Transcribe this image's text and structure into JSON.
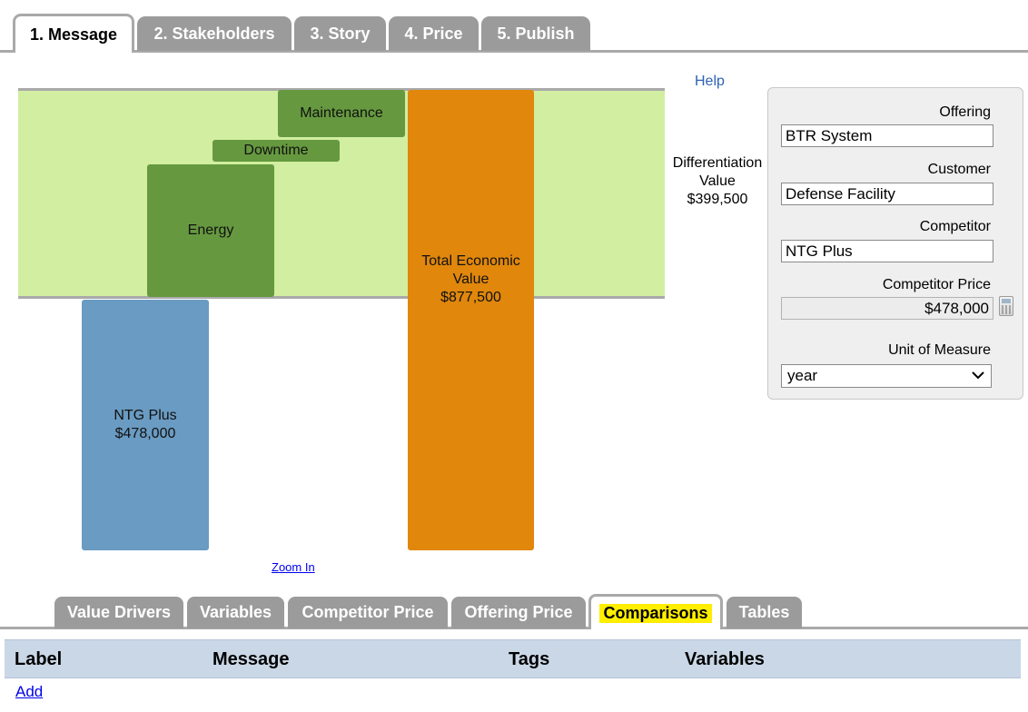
{
  "top_tabs": [
    {
      "label": "1. Message",
      "active": true
    },
    {
      "label": "2. Stakeholders",
      "active": false
    },
    {
      "label": "3. Story",
      "active": false
    },
    {
      "label": "4. Price",
      "active": false
    },
    {
      "label": "5. Publish",
      "active": false
    }
  ],
  "help_link": "Help",
  "chart_data": {
    "type": "bar",
    "bars": [
      {
        "label": "NTG Plus",
        "value_text": "$478,000",
        "value": 478000
      },
      {
        "label": "Energy",
        "value_text": "",
        "value": null
      },
      {
        "label": "Downtime",
        "value_text": "",
        "value": null
      },
      {
        "label": "Maintenance",
        "value_text": "",
        "value": null
      },
      {
        "label": "Total Economic Value",
        "value_text": "$877,500",
        "value": 877500
      }
    ],
    "differentiation": {
      "label": "Differentiation Value",
      "value_text": "$399,500",
      "value": 399500
    },
    "colors": {
      "band": "#d2eea0",
      "drivers": "#66993f",
      "competitor": "#6a9bc2",
      "total": "#e0870c"
    }
  },
  "chart_labels": {
    "competitor_name": "NTG Plus",
    "competitor_value": "$478,000",
    "energy": "Energy",
    "downtime": "Downtime",
    "maintenance": "Maintenance",
    "total_line1": "Total Economic",
    "total_line2": "Value",
    "total_value": "$877,500",
    "diff_line1": "Differentiation",
    "diff_line2": "Value",
    "diff_value": "$399,500"
  },
  "zoom_link": "Zoom In",
  "panel": {
    "offering_label": "Offering",
    "offering_value": "BTR System",
    "customer_label": "Customer",
    "customer_value": "Defense Facility",
    "competitor_label": "Competitor",
    "competitor_value": "NTG Plus",
    "competitor_price_label": "Competitor Price",
    "competitor_price_value": "$478,000",
    "unit_label": "Unit of Measure",
    "unit_value": "year"
  },
  "bottom_tabs": [
    {
      "label": "Value Drivers",
      "active": false
    },
    {
      "label": "Variables",
      "active": false
    },
    {
      "label": "Competitor Price",
      "active": false
    },
    {
      "label": "Offering Price",
      "active": false
    },
    {
      "label": "Comparisons",
      "active": true
    },
    {
      "label": "Tables",
      "active": false
    }
  ],
  "table": {
    "columns": [
      "Label",
      "Message",
      "Tags",
      "Variables"
    ],
    "add_link": "Add"
  }
}
